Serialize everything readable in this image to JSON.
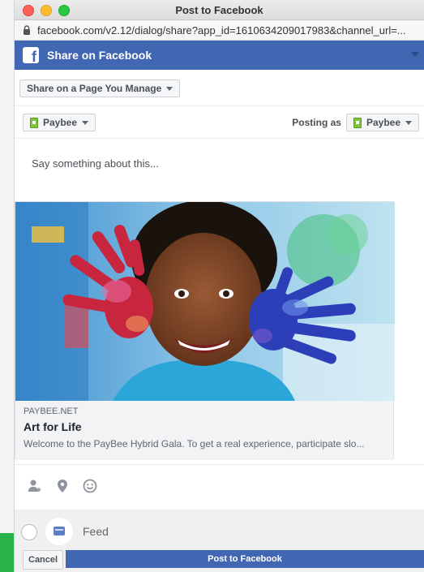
{
  "window": {
    "title": "Post to Facebook",
    "url": "facebook.com/v2.12/dialog/share?app_id=1610634209017983&channel_url=..."
  },
  "header": {
    "title": "Share on Facebook"
  },
  "share_target": {
    "label": "Share on a Page You Manage"
  },
  "page_selector": {
    "value": "Paybee"
  },
  "posting_as": {
    "label": "Posting as",
    "value": "Paybee"
  },
  "compose": {
    "placeholder": "Say something about this..."
  },
  "preview": {
    "domain": "PAYBEE.NET",
    "title": "Art for Life",
    "description": "Welcome to the PayBee Hybrid Gala. To get a real experience, participate slo..."
  },
  "toolbar_icons": [
    "tag-people-icon",
    "location-pin-icon",
    "feeling-emoji-icon"
  ],
  "footer": {
    "feed_label": "Feed",
    "cancel_label": "Cancel",
    "post_label": "Post to Facebook"
  },
  "colors": {
    "facebook_blue": "#4267b2",
    "page_icon_green": "#7fc23c"
  }
}
